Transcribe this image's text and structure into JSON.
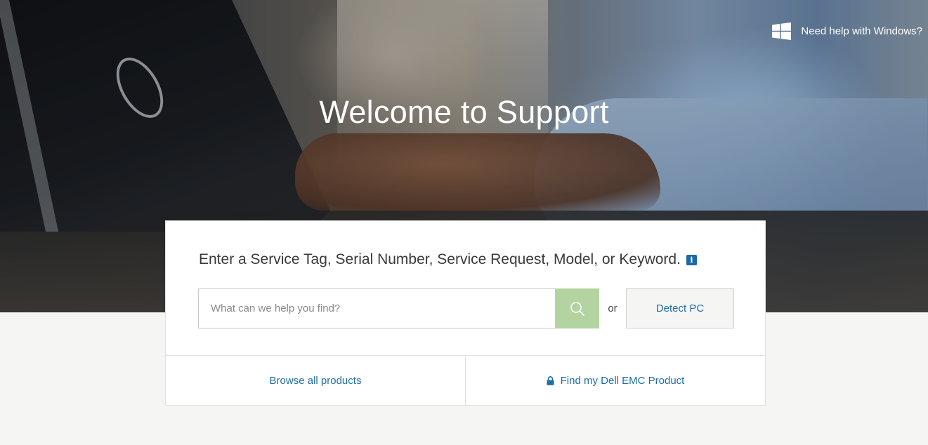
{
  "header": {
    "windows_help": {
      "icon": "windows-logo-icon",
      "label": "Need help with Windows?"
    }
  },
  "hero": {
    "title": "Welcome to Support",
    "image": "person-typing-on-dell-laptop"
  },
  "search_card": {
    "heading": "Enter a Service Tag, Serial Number, Service Request, Model, or Keyword.",
    "info_icon": "info-icon",
    "input": {
      "placeholder": "What can we help you find?",
      "value": ""
    },
    "search_button_icon": "search-icon",
    "or_text": "or",
    "detect_pc_label": "Detect PC",
    "links": [
      {
        "label": "Browse all products",
        "icon": ""
      },
      {
        "label": "Find my Dell EMC Product",
        "icon": "lock-icon"
      }
    ]
  },
  "colors": {
    "link_blue": "#1e6ea8",
    "search_button_green": "#b3d3a0",
    "info_badge_blue": "#1a6aa8",
    "page_background": "#f5f5f3"
  }
}
